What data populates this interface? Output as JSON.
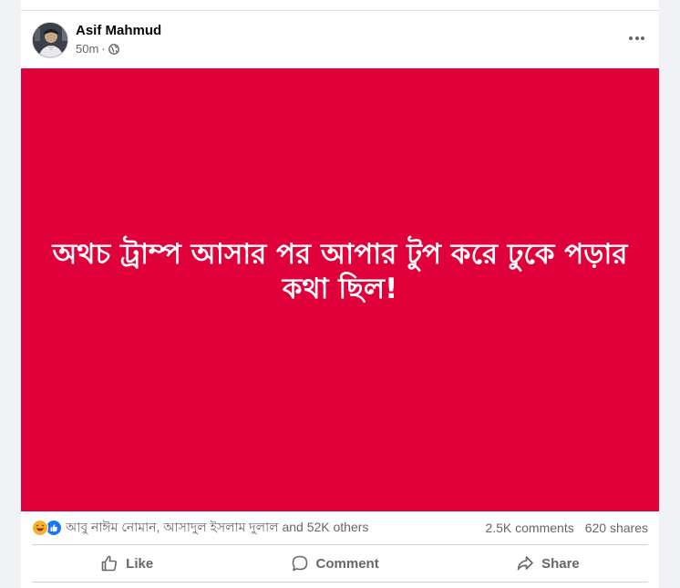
{
  "post": {
    "author": "Asif Mahmud",
    "time": "50m",
    "separator": "·",
    "privacy_icon": "globe-icon",
    "more_icon": "more-options-icon",
    "image_text": "অথচ ট্রাম্প আসার পর আপার টুপ করে ঢুকে পড়ার কথা ছিল!",
    "image_bg_color": "#e0003a"
  },
  "stats": {
    "reaction_icons": [
      "haha-icon",
      "like-icon"
    ],
    "reactors": "আবু নাঈম নোমান, আসাদুল ইসলাম দুলাল and 52K others",
    "comments": "2.5K comments",
    "shares": "620 shares"
  },
  "actions": {
    "like": "Like",
    "comment": "Comment",
    "share": "Share"
  },
  "colors": {
    "page_bg": "#f0f2f5",
    "secondary_text": "#65676b",
    "like_blue": "#1877f2",
    "haha_yellow": "#f7b125"
  }
}
